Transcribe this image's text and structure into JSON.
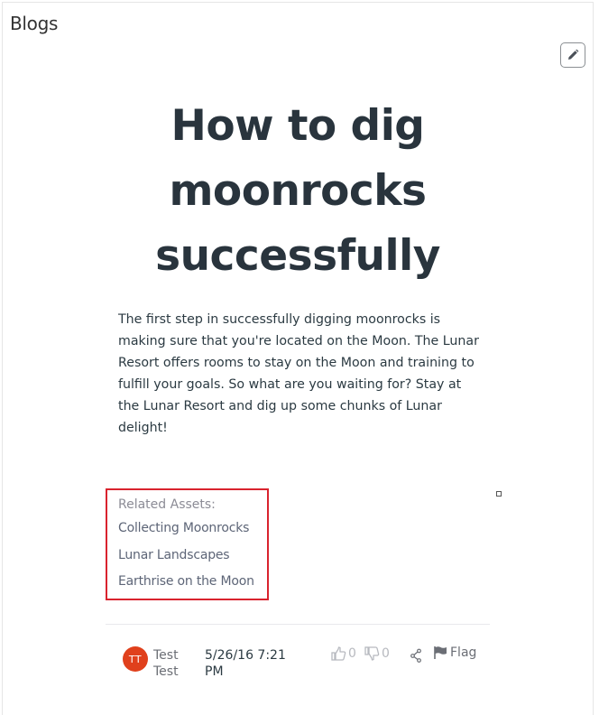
{
  "portlet": {
    "title": "Blogs"
  },
  "entry": {
    "title": "How to dig moonrocks successfully",
    "body": "The first step in successfully digging moonrocks is making sure that you're located on the Moon. The Lunar Resort offers rooms to stay on the Moon and training to fulfill your goals. So what are you waiting for? Stay at the Lunar Resort and dig up some chunks of Lunar delight!"
  },
  "related_assets": {
    "label": "Related Assets:",
    "links": [
      "Collecting Moonrocks",
      "Lunar Landscapes",
      "Earthrise on the Moon"
    ]
  },
  "footer": {
    "avatar_initials": "TT",
    "author": "Test Test",
    "date": "5/26/16 7:21 PM",
    "thumbs_up_count": "0",
    "thumbs_down_count": "0",
    "flag_label": "Flag"
  },
  "colors": {
    "highlight_border": "#d9232e",
    "avatar_bg": "#e0401c",
    "title_text": "#29343d"
  }
}
